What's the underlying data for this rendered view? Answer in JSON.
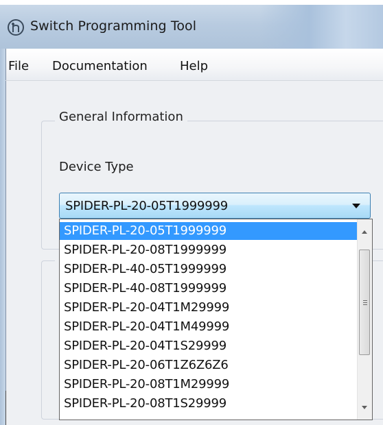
{
  "window": {
    "title": "Switch Programming Tool",
    "app_icon": "hirschmann-logo-icon"
  },
  "menu": {
    "file": "File",
    "documentation": "Documentation",
    "help": "Help"
  },
  "general_information": {
    "legend": "General Information",
    "device_type_label": "Device Type",
    "device_type_value": "SPIDER-PL-20-05T1999999"
  },
  "dropdown": {
    "options": [
      "SPIDER-PL-20-05T1999999",
      "SPIDER-PL-20-08T1999999",
      "SPIDER-PL-40-05T1999999",
      "SPIDER-PL-40-08T1999999",
      "SPIDER-PL-20-04T1M29999",
      "SPIDER-PL-20-04T1M49999",
      "SPIDER-PL-20-04T1S29999",
      "SPIDER-PL-20-06T1Z6Z6Z6",
      "SPIDER-PL-20-08T1M29999",
      "SPIDER-PL-20-08T1S29999"
    ],
    "selected_index": 0
  },
  "colors": {
    "selection": "#3399ff",
    "combo_border": "#3c7fb1"
  }
}
